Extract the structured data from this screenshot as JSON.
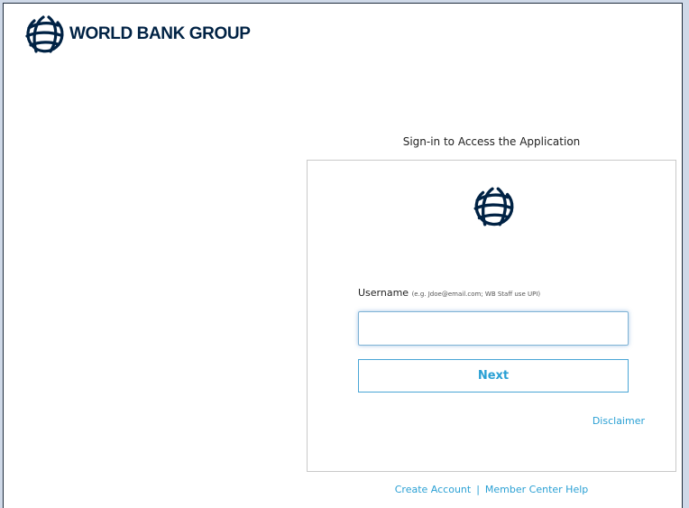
{
  "header": {
    "brand_name": "WORLD BANK GROUP",
    "logo_icon": "world-bank-globe-icon"
  },
  "signin": {
    "heading": "Sign-in to Access the Application",
    "card_logo_icon": "world-bank-globe-icon",
    "username_label": "Username",
    "username_hint": "(e.g. Jdoe@email.com; WB Staff use UPI)",
    "username_value": "",
    "username_placeholder": "",
    "next_label": "Next",
    "disclaimer_label": "Disclaimer"
  },
  "footer": {
    "create_account_label": "Create Account",
    "separator": "|",
    "help_label": "Member Center Help"
  },
  "colors": {
    "brand_navy": "#002244",
    "link_blue": "#2aa0d4",
    "page_border": "#1f2d3d",
    "outer_background": "#cfd9e8"
  }
}
